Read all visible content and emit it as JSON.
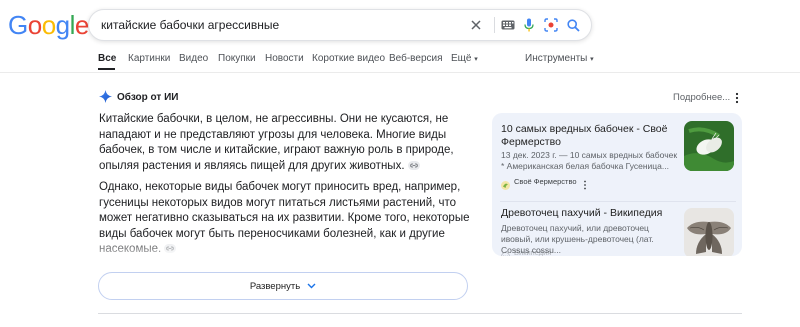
{
  "logo": {
    "letters": [
      "G",
      "o",
      "o",
      "g",
      "l",
      "e"
    ],
    "colors": [
      "#4285F4",
      "#EA4335",
      "#FBBC05",
      "#4285F4",
      "#34A853",
      "#EA4335"
    ]
  },
  "search": {
    "query": "китайские бабочки агрессивные",
    "icons": [
      "close-icon",
      "keyboard-icon",
      "mic-icon",
      "lens-icon",
      "search-icon"
    ]
  },
  "tabs": {
    "items": [
      "Все",
      "Картинки",
      "Видео",
      "Покупки",
      "Новости",
      "Короткие видео",
      "Веб-версия",
      "Ещё"
    ],
    "more_suffix": "▾",
    "tools": "Инструменты",
    "tools_suffix": "▾"
  },
  "ai_overview": {
    "title": "Обзор от ИИ",
    "more": "Подробнее...",
    "paragraph1": "Китайские бабочки, в целом, не агрессивны. Они не кусаются, не нападают и не представляют угрозы для человека. Многие виды бабочек, в том числе и китайские, играют важную роль в природе, опыляя растения и являясь пищей для других животных.",
    "paragraph2": "Однако, некоторые виды бабочек могут приносить вред, например, гусеницы некоторых видов могут питаться листьями растений, что может негативно сказываться на их развитии. Кроме того, некоторые виды бабочек могут быть переносчиками болезней, как и другие насекомые.",
    "expand_label": "Развернуть"
  },
  "sources": [
    {
      "title": "10 самых вредных бабочек - Своё Фермерство",
      "snippet": "13 дек. 2023 г. — 10 самых вредных бабочек * Американская белая бабочка Гусеница...",
      "site": "Своё Фермерство"
    },
    {
      "title": "Древоточец пахучий - Википедия",
      "snippet": "Древоточец пахучий, или древоточец ивовый, или крушень-древоточец (лат. Cossus cossu...",
      "site": "Википедия"
    }
  ],
  "colors": {
    "accent": "#1a73e8",
    "card_bg": "#eef2fa",
    "text": "#202124",
    "muted": "#5f6368"
  }
}
